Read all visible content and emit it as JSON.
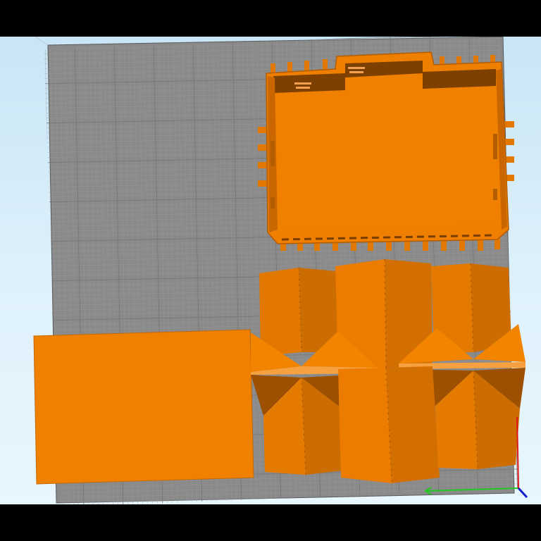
{
  "app": {
    "view": "3d-build-plate-preview"
  },
  "colors": {
    "letterbox": "#000000",
    "sky_top": "#c9e6f6",
    "sky_bottom": "#e8f6fd",
    "bed": "#8a8a8a",
    "grid_minor": "#9a9a9a",
    "grid_major": "#6f6f6f",
    "model_light": "#f08000",
    "model_mid": "#d46f00",
    "model_dark": "#a85600",
    "model_edge": "#7a3f00",
    "axis_x": "#22c822",
    "axis_y": "#e01818",
    "axis_z": "#1020d0"
  },
  "scene": {
    "objects": [
      {
        "name": "enclosure-box-model"
      },
      {
        "name": "flat-panel-model"
      },
      {
        "name": "folded-prism-model"
      }
    ],
    "axes": [
      "x-axis",
      "y-axis",
      "z-axis"
    ]
  }
}
